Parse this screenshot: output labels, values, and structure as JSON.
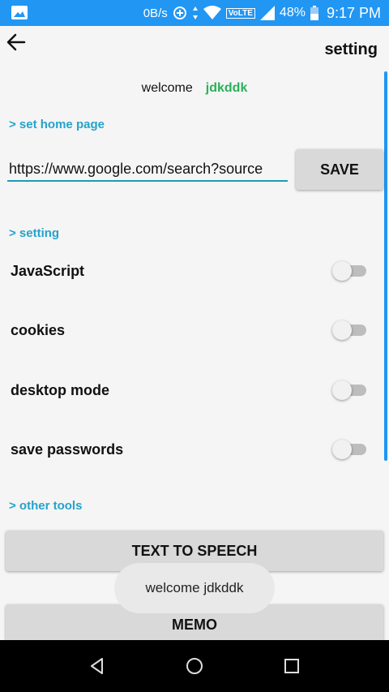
{
  "status_bar": {
    "net_speed": "0B/s",
    "volte": "VoLTE",
    "battery": "48%",
    "time": "9:17 PM"
  },
  "header": {
    "title": "setting"
  },
  "welcome": {
    "text": "welcome",
    "user": "jdkddk"
  },
  "home_page": {
    "section_label": "> set home page",
    "url_value": "https://www.google.com/search?source",
    "save_label": "SAVE"
  },
  "settings": {
    "section_label": "> setting",
    "items": [
      {
        "label": "JavaScript",
        "enabled": false
      },
      {
        "label": "cookies",
        "enabled": false
      },
      {
        "label": "desktop mode",
        "enabled": false
      },
      {
        "label": "save passwords",
        "enabled": false
      }
    ]
  },
  "other_tools": {
    "section_label": "> other tools",
    "tts_label": "TEXT TO SPEECH",
    "memo_label": "MEMO"
  },
  "toast": {
    "text": "welcome jdkddk"
  },
  "colors": {
    "status_bar": "#2196f3",
    "accent": "#24a3cc",
    "username": "#2ab05a"
  }
}
